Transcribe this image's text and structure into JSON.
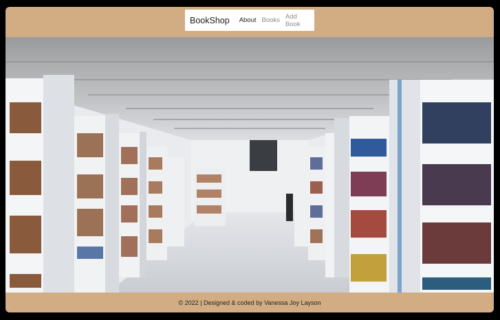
{
  "navbar": {
    "brand": "BookShop",
    "links": [
      {
        "label": "About",
        "active": true
      },
      {
        "label": "Books",
        "active": false
      },
      {
        "label": "Add Book",
        "active": false
      }
    ]
  },
  "hero": {
    "image": "library-bookshelves-photo"
  },
  "footer": {
    "text": "© 2022 | Designed & coded by Vanessa Joy Layson"
  },
  "colors": {
    "frame": "#d2ad84",
    "page_background": "#000000",
    "navbar_background": "#ffffff"
  }
}
